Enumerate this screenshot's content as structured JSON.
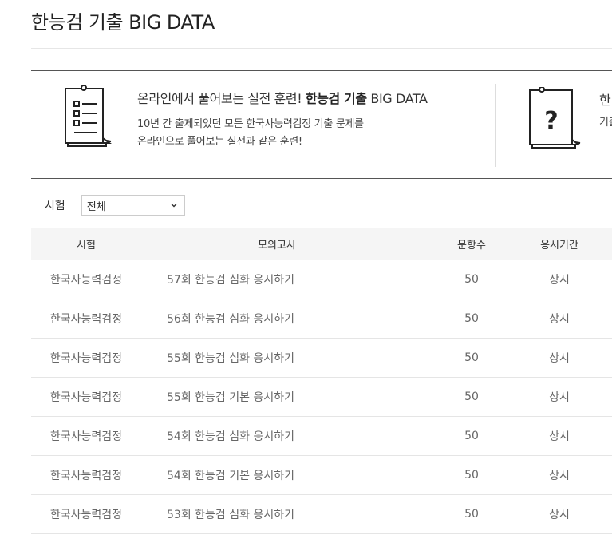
{
  "page": {
    "title": "한능검 기출 BIG DATA"
  },
  "banner": {
    "cards": [
      {
        "headline_prefix": "온라인에서 풀어보는 실전 훈련! ",
        "headline_bold": "한능검 기출",
        "headline_suffix": " BIG DATA",
        "desc_line1": "10년 간 출제되었던 모든 한국사능력검정 기출 문제를",
        "desc_line2": "온라인으로 풀어보는 실전과 같은 훈련!",
        "icon": "document-list-icon"
      },
      {
        "headline": "한",
        "desc": "기출",
        "icon": "question-document-icon"
      }
    ]
  },
  "filter": {
    "label": "시험",
    "selected": "전체"
  },
  "table": {
    "headers": [
      "시험",
      "모의고사",
      "문항수",
      "응시기간"
    ],
    "rows": [
      {
        "exam": "한국사능력검정",
        "mock": "57회 한능검 심화 응시하기",
        "count": "50",
        "period": "상시"
      },
      {
        "exam": "한국사능력검정",
        "mock": "56회 한능검 심화 응시하기",
        "count": "50",
        "period": "상시"
      },
      {
        "exam": "한국사능력검정",
        "mock": "55회 한능검 심화 응시하기",
        "count": "50",
        "period": "상시"
      },
      {
        "exam": "한국사능력검정",
        "mock": "55회 한능검 기본 응시하기",
        "count": "50",
        "period": "상시"
      },
      {
        "exam": "한국사능력검정",
        "mock": "54회 한능검 심화 응시하기",
        "count": "50",
        "period": "상시"
      },
      {
        "exam": "한국사능력검정",
        "mock": "54회 한능검 기본 응시하기",
        "count": "50",
        "period": "상시"
      },
      {
        "exam": "한국사능력검정",
        "mock": "53회 한능검 심화 응시하기",
        "count": "50",
        "period": "상시"
      }
    ]
  }
}
